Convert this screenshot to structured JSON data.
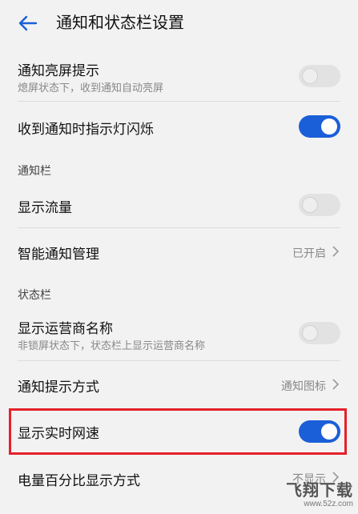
{
  "header": {
    "title": "通知和状态栏设置"
  },
  "rows": {
    "notify_wake": {
      "label": "通知亮屏提示",
      "sub": "熄屏状态下，收到通知自动亮屏",
      "toggle": "off"
    },
    "led_flash": {
      "label": "收到通知时指示灯闪烁",
      "toggle": "on"
    },
    "section_notif": "通知栏",
    "show_traffic": {
      "label": "显示流量",
      "toggle": "off"
    },
    "smart_notify": {
      "label": "智能通知管理",
      "value": "已开启"
    },
    "section_status": "状态栏",
    "carrier_name": {
      "label": "显示运营商名称",
      "sub": "非锁屏状态下，状态栏上显示运营商名称",
      "toggle": "off"
    },
    "notify_style": {
      "label": "通知提示方式",
      "value": "通知图标"
    },
    "net_speed": {
      "label": "显示实时网速",
      "toggle": "on"
    },
    "battery_pct": {
      "label": "电量百分比显示方式",
      "value": "不显示"
    }
  },
  "watermark": {
    "brand": "飞翔下载",
    "url": "www.52z.com"
  },
  "colors": {
    "accent": "#1b5fd8",
    "highlight": "#e5202a"
  }
}
